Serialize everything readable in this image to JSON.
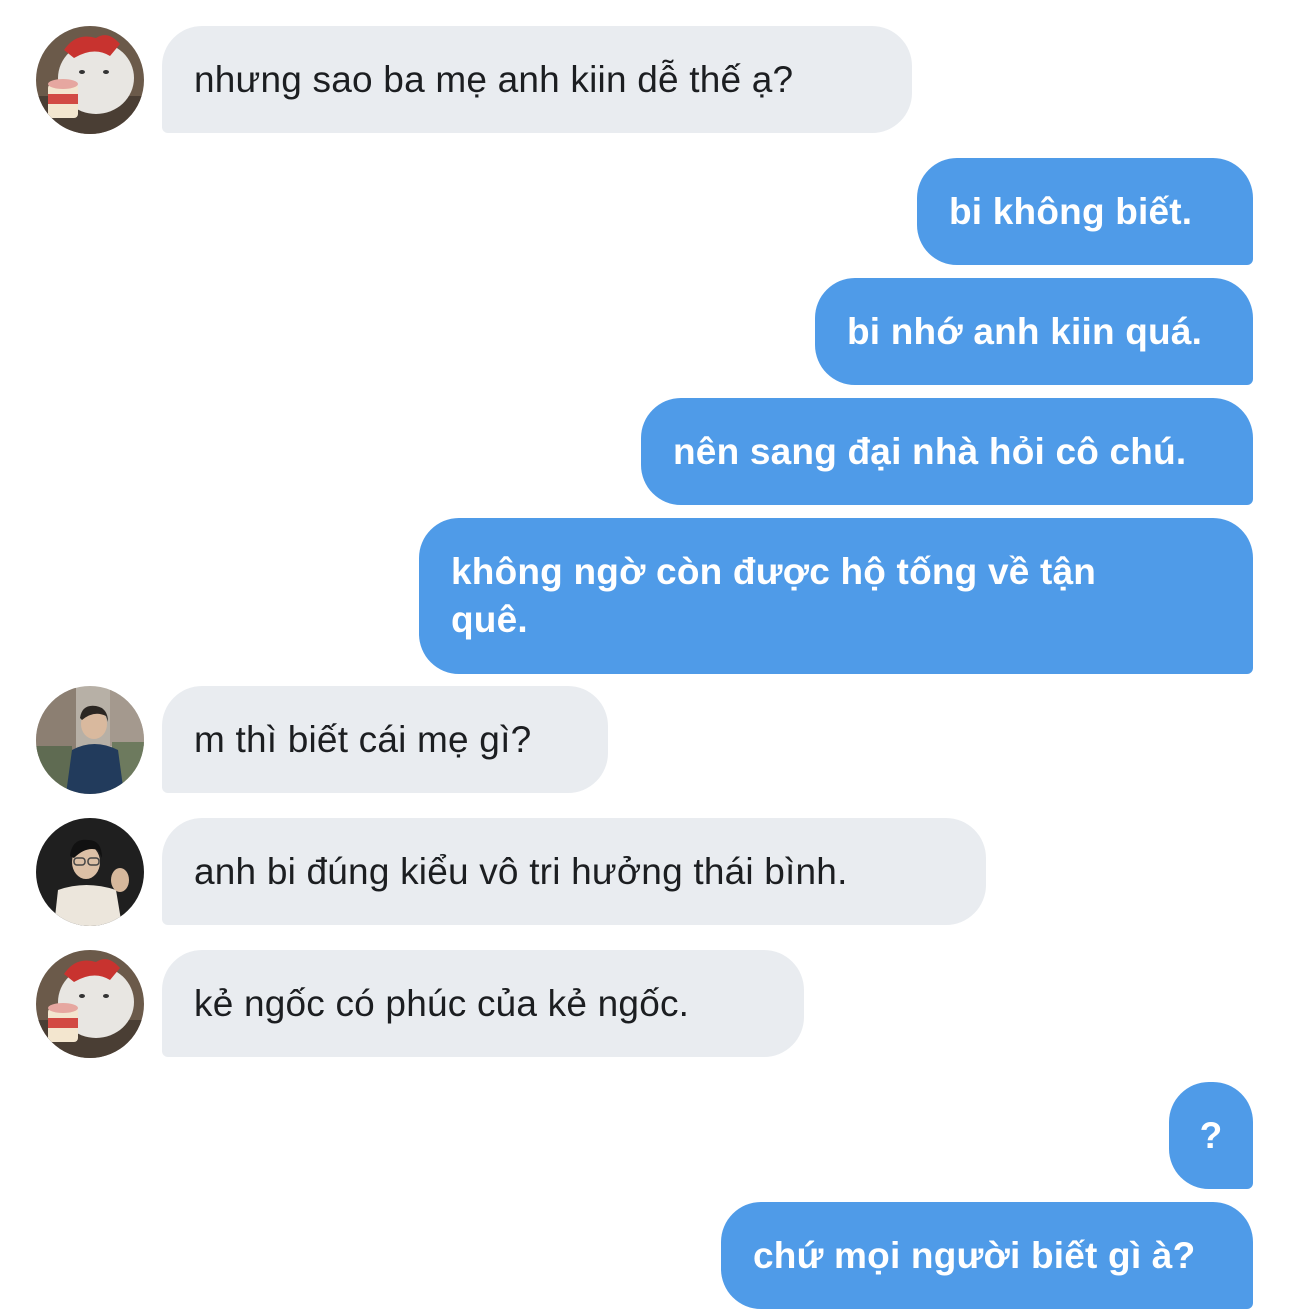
{
  "conversation": {
    "messages": [
      {
        "sender": "other",
        "avatar": "bear-avatar",
        "text": "nhưng sao ba mẹ anh kiin dễ thế ạ?"
      },
      {
        "sender": "me",
        "text": "bi không biết."
      },
      {
        "sender": "me",
        "text": "bi nhớ anh kiin quá."
      },
      {
        "sender": "me",
        "text": "nên sang đại nhà hỏi cô chú."
      },
      {
        "sender": "me",
        "text": "không ngờ còn được hộ tống về tận quê."
      },
      {
        "sender": "other",
        "avatar": "street-photo-avatar",
        "text": "m thì biết cái mẹ gì?"
      },
      {
        "sender": "other",
        "avatar": "portrait-photo-avatar",
        "text": "anh bi đúng kiểu vô tri hưởng thái bình."
      },
      {
        "sender": "other",
        "avatar": "bear-avatar",
        "text": "kẻ ngốc có phúc của kẻ ngốc."
      },
      {
        "sender": "me",
        "text": "?"
      },
      {
        "sender": "me",
        "text": "chứ mọi người biết gì à?"
      }
    ]
  },
  "colors": {
    "incoming_bubble": "#e9ecf0",
    "incoming_text": "#1c1e21",
    "outgoing_bubble": "#4f9be8",
    "outgoing_text": "#ffffff",
    "background": "#ffffff"
  }
}
